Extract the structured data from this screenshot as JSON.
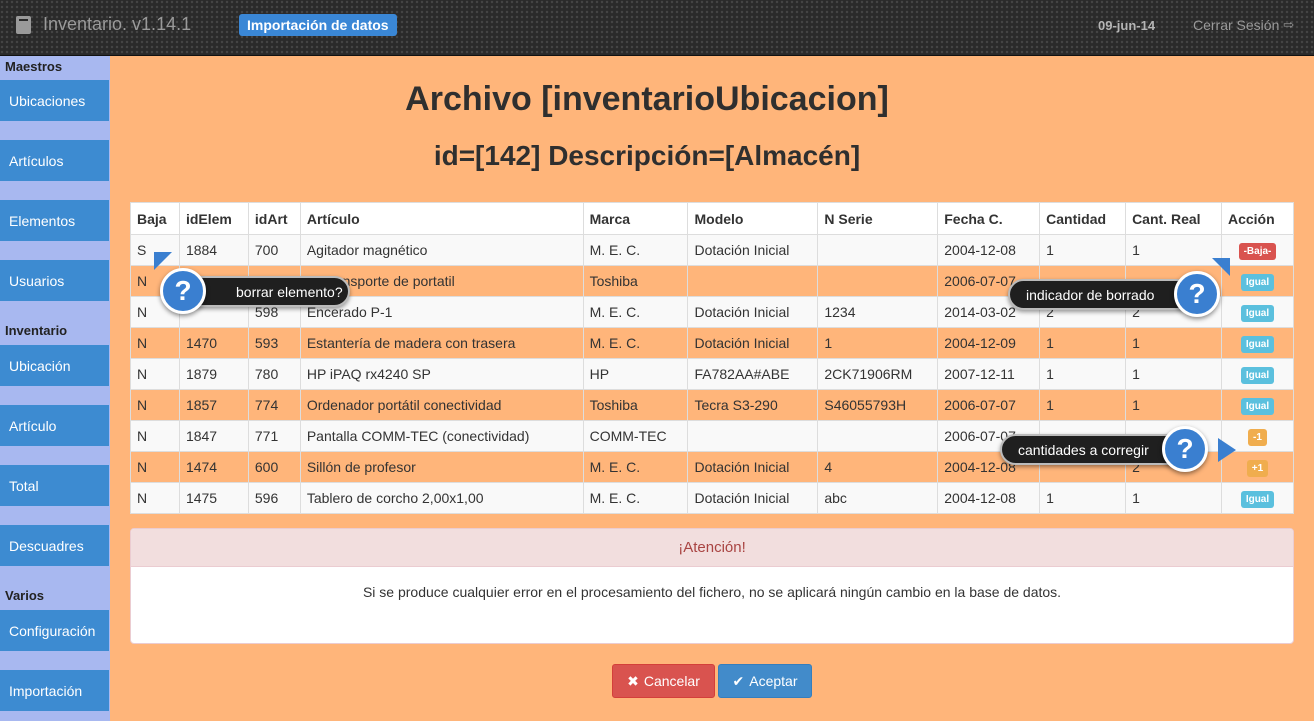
{
  "header": {
    "app_title": "Inventario. v1.14.1",
    "module_badge": "Importación de datos",
    "date": "09-jun-14",
    "logout_label": "Cerrar Sesión"
  },
  "sidebar": {
    "section_maestros": "Maestros",
    "maestros": [
      "Ubicaciones",
      "Artículos",
      "Elementos",
      "Usuarios"
    ],
    "section_inventario": "Inventario",
    "inventario": [
      "Ubicación",
      "Artículo",
      "Total",
      "Descuadres"
    ],
    "section_varios": "Varios",
    "varios": [
      "Configuración",
      "Importación"
    ]
  },
  "main": {
    "title": "Archivo [inventarioUbicacion]",
    "subtitle": "id=[142] Descripción=[Almacén]"
  },
  "table": {
    "headers": [
      "Baja",
      "idElem",
      "idArt",
      "Artículo",
      "Marca",
      "Modelo",
      "N Serie",
      "Fecha C.",
      "Cantidad",
      "Cant. Real",
      "Acción"
    ],
    "rows": [
      {
        "baja": "S",
        "idElem": "1884",
        "idArt": "700",
        "articulo": "Agitador magnético",
        "marca": "M. E. C.",
        "modelo": "Dotación Inicial",
        "serie": "",
        "fecha": "2004-12-08",
        "cantidad": "1",
        "real": "1",
        "accion": "-Baja-",
        "accion_type": "danger"
      },
      {
        "baja": "N",
        "idElem": "",
        "idArt": "",
        "articulo": "de transporte de portatil",
        "marca": "Toshiba",
        "modelo": "",
        "serie": "",
        "fecha": "2006-07-07",
        "cantidad": "",
        "real": "",
        "accion": "Igual",
        "accion_type": "info"
      },
      {
        "baja": "N",
        "idElem": "",
        "idArt": "598",
        "articulo": "Encerado P-1",
        "marca": "M. E. C.",
        "modelo": "Dotación Inicial",
        "serie": "1234",
        "fecha": "2014-03-02",
        "cantidad": "2",
        "real": "2",
        "accion": "Igual",
        "accion_type": "info"
      },
      {
        "baja": "N",
        "idElem": "1470",
        "idArt": "593",
        "articulo": "Estantería de madera con trasera",
        "marca": "M. E. C.",
        "modelo": "Dotación Inicial",
        "serie": "1",
        "fecha": "2004-12-09",
        "cantidad": "1",
        "real": "1",
        "accion": "Igual",
        "accion_type": "info"
      },
      {
        "baja": "N",
        "idElem": "1879",
        "idArt": "780",
        "articulo": "HP iPAQ rx4240 SP",
        "marca": "HP",
        "modelo": "FA782AA#ABE",
        "serie": "2CK71906RM",
        "fecha": "2007-12-11",
        "cantidad": "1",
        "real": "1",
        "accion": "Igual",
        "accion_type": "info"
      },
      {
        "baja": "N",
        "idElem": "1857",
        "idArt": "774",
        "articulo": "Ordenador portátil conectividad",
        "marca": "Toshiba",
        "modelo": "Tecra S3-290",
        "serie": "S46055793H",
        "fecha": "2006-07-07",
        "cantidad": "1",
        "real": "1",
        "accion": "Igual",
        "accion_type": "info"
      },
      {
        "baja": "N",
        "idElem": "1847",
        "idArt": "771",
        "articulo": "Pantalla COMM-TEC (conectividad)",
        "marca": "COMM-TEC",
        "modelo": "",
        "serie": "",
        "fecha": "2006-07-07",
        "cantidad": "",
        "real": "",
        "accion": "-1",
        "accion_type": "warning"
      },
      {
        "baja": "N",
        "idElem": "1474",
        "idArt": "600",
        "articulo": "Sillón de profesor",
        "marca": "M. E. C.",
        "modelo": "Dotación Inicial",
        "serie": "4",
        "fecha": "2004-12-08",
        "cantidad": "",
        "real": "2",
        "accion": "+1",
        "accion_type": "warning"
      },
      {
        "baja": "N",
        "idElem": "1475",
        "idArt": "596",
        "articulo": "Tablero de corcho 2,00x1,00",
        "marca": "M. E. C.",
        "modelo": "Dotación Inicial",
        "serie": "abc",
        "fecha": "2004-12-08",
        "cantidad": "1",
        "real": "1",
        "accion": "Igual",
        "accion_type": "info"
      }
    ]
  },
  "callouts": {
    "borrar": "borrar elemento?",
    "indicador": "indicador de borrado",
    "corregir": "cantidades a corregir",
    "icon_glyph": "?"
  },
  "alert": {
    "title": "¡Atención!",
    "message": "Si se produce cualquier error en el procesamiento del fichero, no se aplicará ningún cambio en la base de datos."
  },
  "buttons": {
    "cancel": "Cancelar",
    "accept": "Aceptar"
  },
  "colors": {
    "background": "#ffb57a",
    "sidebar": "#a8b8f0",
    "nav_item": "#3d8bd1",
    "primary": "#428bca",
    "danger": "#d9534f",
    "info": "#5bc0de",
    "warning": "#f0ad4e"
  }
}
